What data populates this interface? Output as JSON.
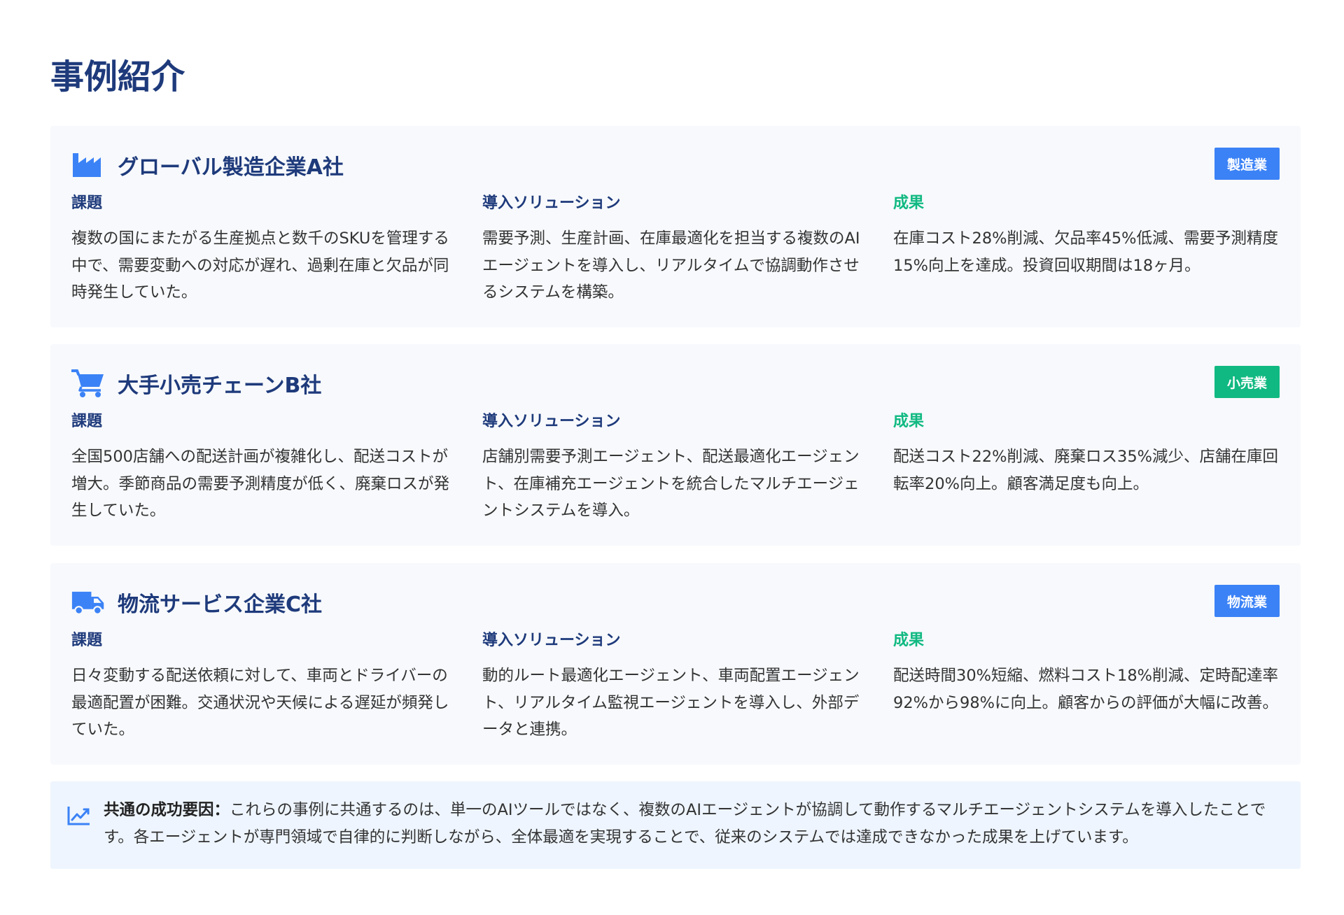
{
  "page": {
    "title": "事例紹介"
  },
  "columns": {
    "issue_heading": "課題",
    "solution_heading": "導入ソリューション",
    "result_heading": "成果"
  },
  "cases": [
    {
      "icon": "factory-icon",
      "title": "グローバル製造企業A社",
      "badge": "製造業",
      "badge_color": "#3b82f6",
      "issue": "複数の国にまたがる生産拠点と数千のSKUを管理する中で、需要変動への対応が遅れ、過剰在庫と欠品が同時発生していた。",
      "solution": "需要予測、生産計画、在庫最適化を担当する複数のAIエージェントを導入し、リアルタイムで協調動作させるシステムを構築。",
      "result": "在庫コスト28%削減、欠品率45%低減、需要予測精度15%向上を達成。投資回収期間は18ヶ月。"
    },
    {
      "icon": "shopping-cart-icon",
      "title": "大手小売チェーンB社",
      "badge": "小売業",
      "badge_color": "#10b981",
      "issue": "全国500店舗への配送計画が複雑化し、配送コストが増大。季節商品の需要予測精度が低く、廃棄ロスが発生していた。",
      "solution": "店舗別需要予測エージェント、配送最適化エージェント、在庫補充エージェントを統合したマルチエージェントシステムを導入。",
      "result": "配送コスト22%削減、廃棄ロス35%減少、店舗在庫回転率20%向上。顧客満足度も向上。"
    },
    {
      "icon": "truck-icon",
      "title": "物流サービス企業C社",
      "badge": "物流業",
      "badge_color": "#3b82f6",
      "issue": "日々変動する配送依頼に対して、車両とドライバーの最適配置が困難。交通状況や天候による遅延が頻発していた。",
      "solution": "動的ルート最適化エージェント、車両配置エージェント、リアルタイム監視エージェントを導入し、外部データと連携。",
      "result": "配送時間30%短縮、燃料コスト18%削減、定時配達率92%から98%に向上。顧客からの評価が大幅に改善。"
    }
  ],
  "summary": {
    "icon": "chart-line-icon",
    "label": "共通の成功要因：",
    "text": "これらの事例に共通するのは、単一のAIツールではなく、複数のAIエージェントが協調して動作するマルチエージェントシステムを導入したことです。各エージェントが専門領域で自律的に判断しながら、全体最適を実現することで、従来のシステムでは達成できなかった成果を上げています。"
  },
  "colors": {
    "title": "#1e3a7b",
    "accent_blue": "#3b82f6",
    "accent_green": "#10b981",
    "card_bg": "#f7f9fc",
    "summary_bg": "#eef5fe"
  }
}
